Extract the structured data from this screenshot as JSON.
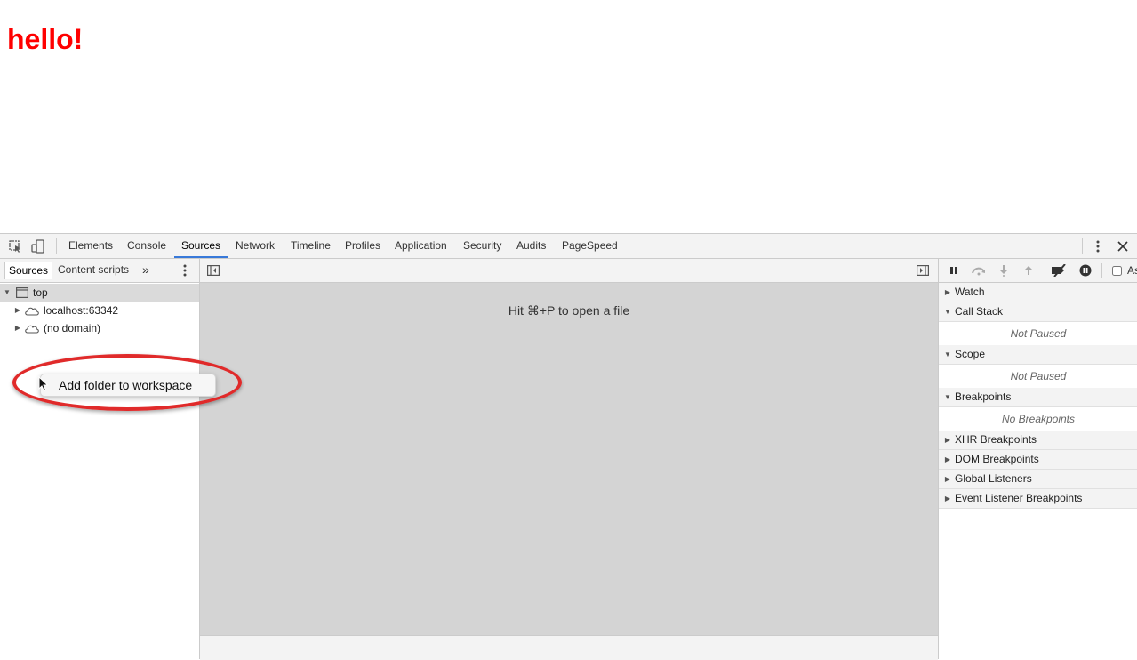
{
  "page": {
    "heading": "hello!",
    "heading_color": "#ff0000"
  },
  "devtools": {
    "tabs": [
      {
        "label": "Elements"
      },
      {
        "label": "Console"
      },
      {
        "label": "Sources"
      },
      {
        "label": "Network"
      },
      {
        "label": "Timeline"
      },
      {
        "label": "Profiles"
      },
      {
        "label": "Application"
      },
      {
        "label": "Security"
      },
      {
        "label": "Audits"
      },
      {
        "label": "PageSpeed"
      }
    ],
    "selected_tab": "Sources",
    "accent_color": "#3879d9"
  },
  "navigator": {
    "tabs": [
      {
        "label": "Sources"
      },
      {
        "label": "Content scripts"
      }
    ],
    "more_tabs_glyph": "»",
    "tree": [
      {
        "label": "top",
        "icon": "frame-icon",
        "expanded": true
      },
      {
        "label": "localhost:63342",
        "icon": "cloud-icon",
        "expanded": false
      },
      {
        "label": "(no domain)",
        "icon": "cloud-icon",
        "expanded": false
      }
    ]
  },
  "context_menu": {
    "items": [
      {
        "label": "Add folder to workspace"
      }
    ],
    "highlight_color": "#e02a2a"
  },
  "editor": {
    "hint": "Hit ⌘+P to open a file"
  },
  "debugger": {
    "async_label": "As",
    "sections": [
      {
        "title": "Watch",
        "expanded": false,
        "body": ""
      },
      {
        "title": "Call Stack",
        "expanded": true,
        "body": "Not Paused"
      },
      {
        "title": "Scope",
        "expanded": true,
        "body": "Not Paused"
      },
      {
        "title": "Breakpoints",
        "expanded": true,
        "body": "No Breakpoints"
      },
      {
        "title": "XHR Breakpoints",
        "expanded": false,
        "body": ""
      },
      {
        "title": "DOM Breakpoints",
        "expanded": false,
        "body": ""
      },
      {
        "title": "Global Listeners",
        "expanded": false,
        "body": ""
      },
      {
        "title": "Event Listener Breakpoints",
        "expanded": false,
        "body": ""
      }
    ]
  }
}
